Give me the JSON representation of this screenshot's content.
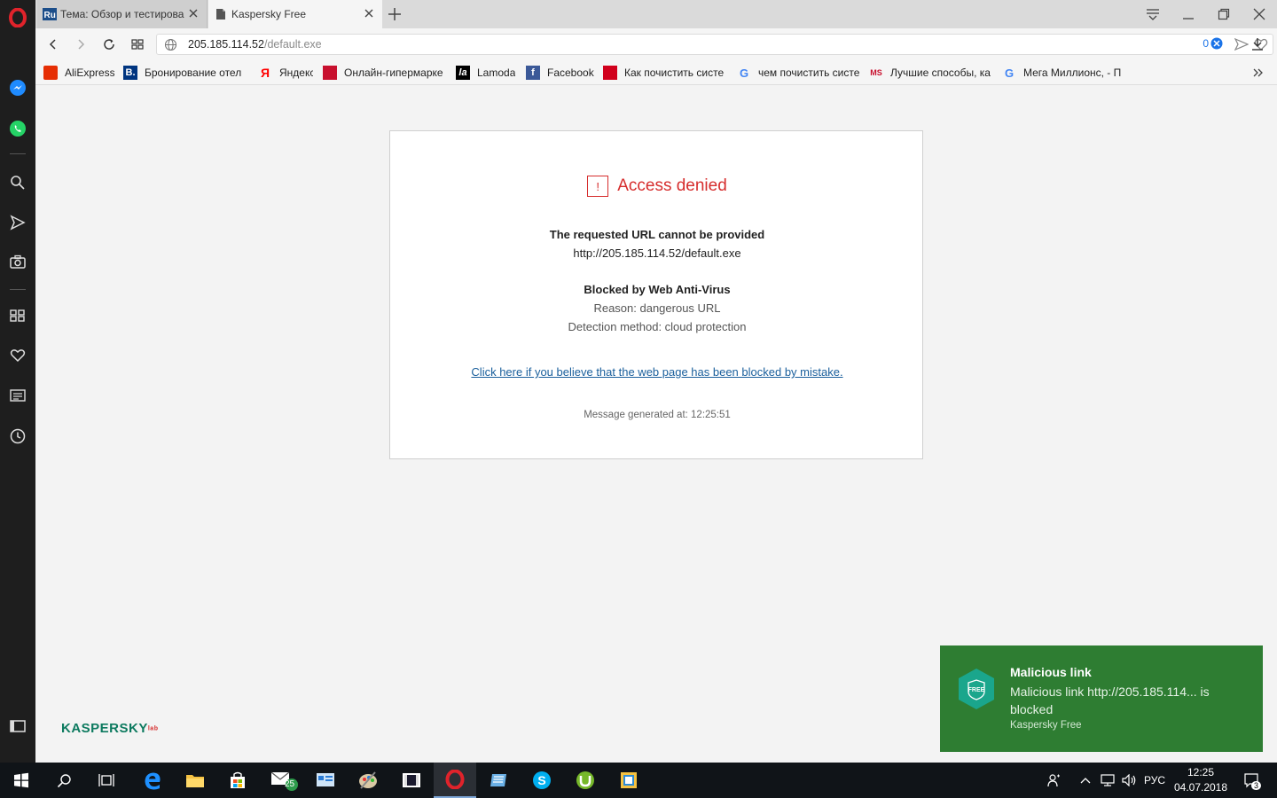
{
  "browser": {
    "tabs": [
      {
        "label": "Тема: Обзор и тестирова",
        "favicon": "ru-board-icon"
      },
      {
        "label": "Kaspersky Free",
        "favicon": "document-icon"
      }
    ],
    "address": {
      "host": "205.185.114.52",
      "path": "/default.exe",
      "adblock_count": "0"
    },
    "bookmarks": [
      {
        "label": "AliExpress",
        "icon_color": "#e62e04"
      },
      {
        "label": "Бронирование отел",
        "icon_text": "B.",
        "icon_color": "#003580"
      },
      {
        "label": "Яндекс",
        "icon_text": "Я",
        "icon_color": "#ff0000"
      },
      {
        "label": "Онлайн-гипермарке",
        "icon_color": "#c8102e"
      },
      {
        "label": "Lamoda",
        "icon_text": "la",
        "icon_color": "#000000"
      },
      {
        "label": "Facebook",
        "icon_text": "f",
        "icon_color": "#3b5998"
      },
      {
        "label": "Как почистить систе",
        "icon_color": "#d1001c"
      },
      {
        "label": "чем почистить систе",
        "icon_text": "G",
        "icon_color": "#4285f4"
      },
      {
        "label": "Лучшие способы, ка",
        "icon_text": "MS",
        "icon_color": "#c8102e"
      },
      {
        "label": "Мега Миллионс, - П",
        "icon_text": "G",
        "icon_color": "#4285f4"
      }
    ]
  },
  "page": {
    "title": "Access denied",
    "requested_heading": "The requested URL cannot be provided",
    "requested_url": "http://205.185.114.52/default.exe",
    "blocked_heading": "Blocked by Web Anti-Virus",
    "reason": "Reason: dangerous URL",
    "detection": "Detection method: cloud protection",
    "mistake_link": "Click here if you believe that the web page has been blocked by mistake.",
    "generated": "Message generated at: 12:25:51",
    "logo": "KASPERSKY",
    "logo_suffix": "lab"
  },
  "toast": {
    "badge": "FREE",
    "title": "Malicious link",
    "body": "Malicious link http://205.185.114... is blocked",
    "source": "Kaspersky Free"
  },
  "taskbar": {
    "mail_badge": "25",
    "language": "РУС",
    "time": "12:25",
    "date": "04.07.2018",
    "notifications": "3"
  },
  "colors": {
    "danger": "#d62d2d",
    "toast_bg": "#2e7d32",
    "link": "#1a5f9c"
  }
}
